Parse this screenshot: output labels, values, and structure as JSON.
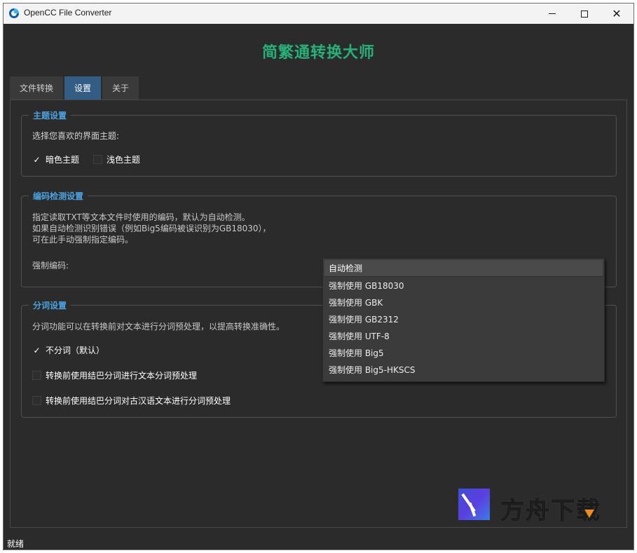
{
  "window": {
    "title": "OpenCC File Converter",
    "app_heading": "简繁通转换大师"
  },
  "tabs": [
    {
      "label": "文件转换",
      "active": false
    },
    {
      "label": "设置",
      "active": true
    },
    {
      "label": "关于",
      "active": false
    }
  ],
  "theme_group": {
    "title": "主题设置",
    "prompt": "选择您喜欢的界面主题:",
    "options": [
      {
        "label": "暗色主题",
        "checked": true
      },
      {
        "label": "浅色主题",
        "checked": false
      }
    ]
  },
  "encoding_group": {
    "title": "编码检测设置",
    "desc_line1": "指定读取TXT等文本文件时使用的编码，默认为自动检测。",
    "desc_line2": "如果自动检测识别错误（例如Big5编码被误识别为GB18030），",
    "desc_line3": "可在此手动强制指定编码。",
    "force_label": "强制编码:",
    "dropdown": {
      "selected": "自动检测",
      "options": [
        "强制使用 GB18030",
        "强制使用 GBK",
        "强制使用 GB2312",
        "强制使用 UTF-8",
        "强制使用 Big5",
        "强制使用 Big5-HKSCS"
      ]
    }
  },
  "segment_group": {
    "title": "分词设置",
    "desc": "分词功能可以在转换前对文本进行分词预处理，以提高转换准确性。",
    "options": [
      {
        "label": "不分词（默认）",
        "checked": true
      },
      {
        "label": "转换前使用结巴分词进行文本分词预处理",
        "checked": false
      },
      {
        "label": "转换前使用结巴分词对古汉语文本进行分词预处理",
        "checked": false
      }
    ]
  },
  "watermark": {
    "text": "方舟下载"
  },
  "status": {
    "text": "就绪"
  },
  "glyphs": {
    "check": "✓",
    "close": "✕"
  },
  "colors": {
    "accent_green": "#26b07a",
    "group_title_blue": "#4aa3e0",
    "active_tab": "#345d85"
  }
}
